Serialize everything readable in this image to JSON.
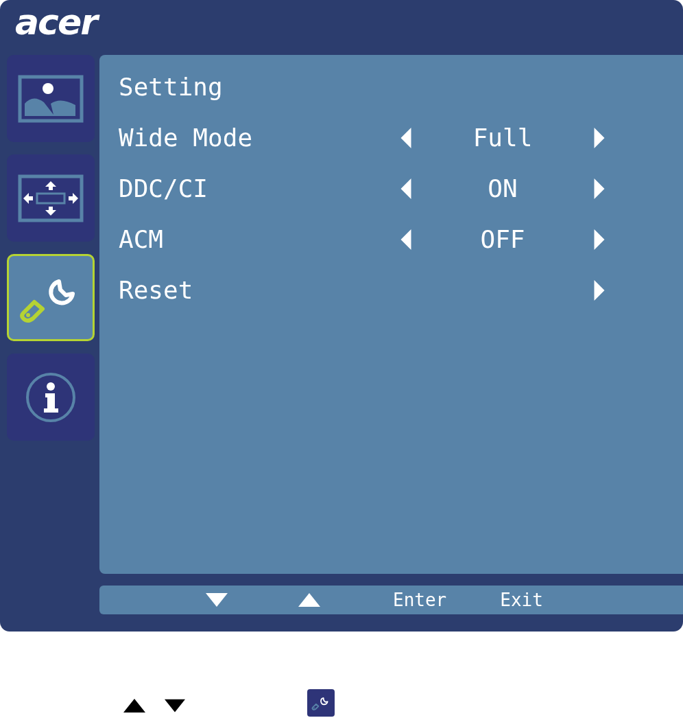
{
  "logo": "acer",
  "tabs": [
    {
      "kind": "picture",
      "selected": false
    },
    {
      "kind": "display",
      "selected": false
    },
    {
      "kind": "setting",
      "selected": true
    },
    {
      "kind": "info",
      "selected": false
    }
  ],
  "menu": {
    "title": "Setting",
    "items": [
      {
        "kind": "option",
        "label": "Wide Mode",
        "value": "Full"
      },
      {
        "kind": "option",
        "label": "DDC/CI",
        "value": "ON"
      },
      {
        "kind": "option",
        "label": "ACM",
        "value": "OFF"
      },
      {
        "kind": "action",
        "label": "Reset"
      }
    ]
  },
  "footer": {
    "keys": [
      "Enter",
      "Exit"
    ]
  }
}
